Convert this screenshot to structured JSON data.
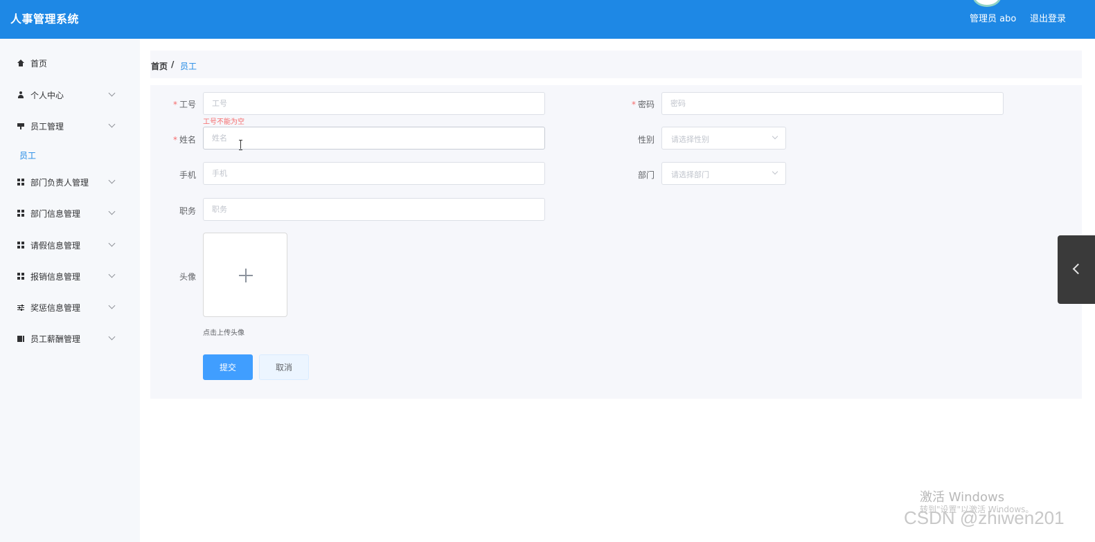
{
  "header": {
    "title": "人事管理系统",
    "user": "管理员 abo",
    "logout": "退出登录"
  },
  "sidebar": {
    "items": [
      {
        "label": "首页",
        "icon": "house-icon"
      },
      {
        "label": "个人中心",
        "icon": "user-icon"
      },
      {
        "label": "员工管理",
        "icon": "tv-icon"
      },
      {
        "label": "部门负责人管理",
        "icon": "grid-icon"
      },
      {
        "label": "部门信息管理",
        "icon": "grid-icon"
      },
      {
        "label": "请假信息管理",
        "icon": "grid-icon"
      },
      {
        "label": "报销信息管理",
        "icon": "grid-icon"
      },
      {
        "label": "奖惩信息管理",
        "icon": "sliders-icon"
      },
      {
        "label": "员工薪酬管理",
        "icon": "money-icon"
      }
    ],
    "active_sub": "员工"
  },
  "breadcrumb": {
    "home": "首页",
    "separator": "/",
    "current": "员工"
  },
  "form": {
    "gonghao": {
      "label": "工号",
      "placeholder": "工号",
      "error": "工号不能为空"
    },
    "mima": {
      "label": "密码",
      "placeholder": "密码"
    },
    "xingming": {
      "label": "姓名",
      "placeholder": "姓名"
    },
    "xingbie": {
      "label": "性别",
      "placeholder": "请选择性别"
    },
    "shouji": {
      "label": "手机",
      "placeholder": "手机"
    },
    "bumen": {
      "label": "部门",
      "placeholder": "请选择部门"
    },
    "zhiwu": {
      "label": "职务",
      "placeholder": "职务"
    },
    "touxiang": {
      "label": "头像",
      "tip": "点击上传头像"
    },
    "required_mark": "*",
    "submit": "提交",
    "cancel": "取消"
  },
  "watermark": {
    "line1": "激活 Windows",
    "line2": "转到\"设置\"以激活 Windows。",
    "csdn": "CSDN @zhiwen201"
  },
  "colors": {
    "header_bg": "#1e88e5",
    "primary": "#409eff",
    "error": "#f56c6c"
  }
}
